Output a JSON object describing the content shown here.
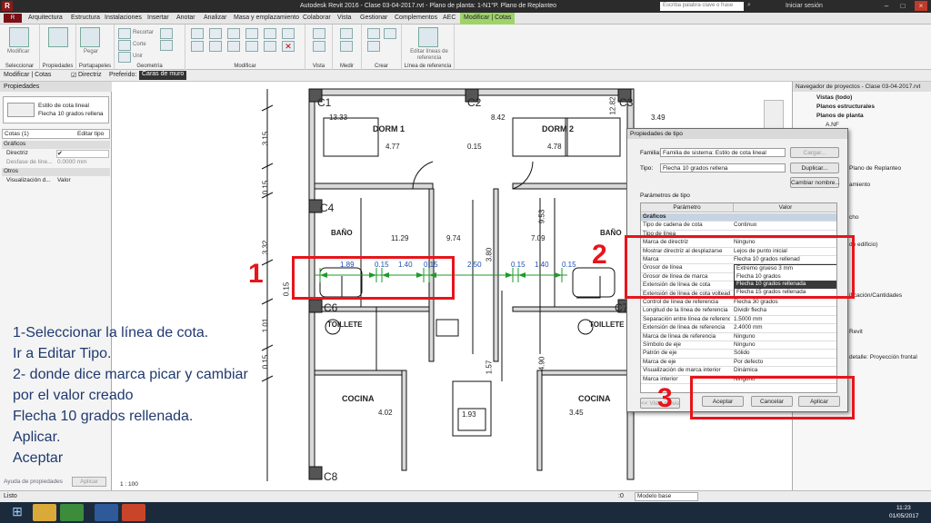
{
  "titlebar": {
    "title": "Autodesk Revit 2016  -  Clase 03-04-2017.rvt - Plano de planta: 1-N1°P. Plano de Replanteo",
    "search_placeholder": "Escriba palabra clave o frase",
    "user": "Iniciar sesión"
  },
  "ribbon": {
    "tabs": [
      "Arquitectura",
      "Estructura",
      "Instalaciones",
      "Insertar",
      "Anotar",
      "Analizar",
      "Masa y emplazamiento",
      "Colaborar",
      "Vista",
      "Gestionar",
      "Complementos",
      "AEC",
      "Modificar | Cotas"
    ],
    "active_tab": "Modificar | Cotas",
    "groups": [
      "Seleccionar",
      "Propiedades",
      "Portapapeles",
      "Geometría",
      "Modificar",
      "Vista",
      "Medir",
      "Crear",
      "Línea de referencia"
    ],
    "items": {
      "modificar": "Modificar",
      "pegar": "Pegar",
      "recortar": "Recortar",
      "unir": "Unir",
      "corte": "Corte",
      "editar_lineas": "Editar líneas de referencia"
    }
  },
  "options_bar": {
    "context": "Modificar | Cotas",
    "directriz": "Directriz",
    "preferido_label": "Preferido:",
    "preferido_value": "Caras de muro"
  },
  "properties": {
    "header": "Propiedades",
    "type_line1": "Estilo de cota lineal",
    "type_line2": "Flecha 10 grados rellena",
    "selector": "Cotas (1)",
    "edit_type": "Editar tipo",
    "group_graficos": "Gráficos",
    "directriz": "Directriz",
    "desfase_label": "Desfase de líne...",
    "desfase_value": "0.0000 mm",
    "group_otros": "Otros",
    "visualizacion": "Visualización d...",
    "visualizacion_value": "Valor",
    "help": "Ayuda de propiedades",
    "apply": "Aplicar"
  },
  "drawing": {
    "rooms": [
      "DORM 1",
      "DORM 2",
      "BAÑO",
      "BAÑO",
      "TOILLETE",
      "TOILLETE",
      "COCINA",
      "COCINA"
    ],
    "columns": [
      "C1",
      "C2",
      "C3",
      "C4",
      "C6",
      "C7",
      "C8"
    ],
    "dims_top": [
      "13.33",
      "8.42",
      "12.82",
      "3.49",
      "4.77",
      "0.15",
      "4.78"
    ],
    "dims_chain": [
      "1.89",
      "0.15",
      "1.40",
      "0.15",
      "2.50",
      "0.15",
      "1.40",
      "0.15"
    ],
    "dims_misc": [
      "11.29",
      "9.74",
      "3.80",
      "7.09",
      "9.53",
      "1.57",
      "4.90",
      "1.93",
      "4.02",
      "3.45"
    ],
    "dims_left": [
      "3.15",
      "0.15",
      "3.32",
      "0.15",
      "1.01",
      "0.15"
    ],
    "scale": "1 : 100"
  },
  "browser": {
    "header": "Navegador de proyectos - Clase 03-04-2017.rvt",
    "items": [
      "Vistas (todo)",
      "Planos estructurales",
      "Planos de planta",
      "A.NF",
      "Plano de Replanteo",
      "amiento",
      "cho",
      "de edificio)",
      "ificación/Cantidades",
      "Revit",
      "detalle: Proyección frontal"
    ]
  },
  "dialog": {
    "title": "Propiedades de tipo",
    "familia_label": "Familia:",
    "familia_value": "Familia de sistema: Estilo de cota lineal",
    "tipo_label": "Tipo:",
    "tipo_value": "Flecha 10 grados rellena",
    "cargar": "Cargar...",
    "duplicar": "Duplicar...",
    "cambiar": "Cambiar nombre...",
    "params_label": "Parámetros de tipo",
    "col_param": "Parámetro",
    "col_valor": "Valor",
    "rows": [
      {
        "p": "Gráficos",
        "v": "",
        "group": true
      },
      {
        "p": "Tipo de cadena de cota",
        "v": "Continuo"
      },
      {
        "p": "Tipo de línea",
        "v": ""
      },
      {
        "p": "Marca de directriz",
        "v": "Ninguno"
      },
      {
        "p": "Mostrar directriz al desplazarse",
        "v": "Lejos de punto inicial"
      },
      {
        "p": "Marca",
        "v": "Flecha 10 grados rellenad"
      },
      {
        "p": "Grosor de línea",
        "v": "Extremo grueso 3 mm"
      },
      {
        "p": "Grosor de línea de marca",
        "v": "Flecha 10 grados"
      },
      {
        "p": "Extensión de línea de cota",
        "v": "Flecha 10 grados rellenada"
      },
      {
        "p": "Extensión de línea de cota volteada",
        "v": "Flecha 15 grados rellenada"
      },
      {
        "p": "Control de línea de referencia",
        "v": "Flecha 30 grados"
      },
      {
        "p": "Longitud de la línea de referencia",
        "v": "Dividir flecha"
      },
      {
        "p": "Separación entre línea de referencia",
        "v": "1.5000 mm"
      },
      {
        "p": "Extensión de línea de referencia",
        "v": "2.4000 mm"
      },
      {
        "p": "Marca de línea de referencia",
        "v": "Ninguno"
      },
      {
        "p": "Símbolo de eje",
        "v": "Ninguno"
      },
      {
        "p": "Patrón de eje",
        "v": "Sólido"
      },
      {
        "p": "Marca de eje",
        "v": "Por defecto"
      },
      {
        "p": "Visualización de marca interior",
        "v": "Dinámica"
      },
      {
        "p": "Marca interior",
        "v": "Ninguno"
      }
    ],
    "dropdown": [
      "Extremo grueso 3 mm",
      "Flecha 10 grados",
      "Flecha 10 grados rellenada",
      "Flecha 15 grados rellenada"
    ],
    "preview": "<< Vista previa",
    "aceptar": "Aceptar",
    "cancelar": "Cancelar",
    "aplicar": "Aplicar"
  },
  "annotations": {
    "n1": "1",
    "n2": "2",
    "n3": "3",
    "lines": [
      "1-Seleccionar la línea de cota.",
      "Ir a Editar Tipo.",
      "2- donde dice marca picar y cambiar",
      "por el valor creado",
      "Flecha 10 grados rellenada.",
      "Aplicar.",
      "Aceptar"
    ]
  },
  "statusbar": {
    "ready": "Listo",
    "model": "Modelo base",
    "coord": ":0"
  },
  "taskbar": {
    "time": "11:23",
    "date": "01/05/2017"
  },
  "colors": {
    "annotation_red": "#e8141b",
    "ribbon_active": "#9ed36a",
    "dim_green": "#1e9a2a",
    "instruction_blue": "#1f3a6e"
  }
}
